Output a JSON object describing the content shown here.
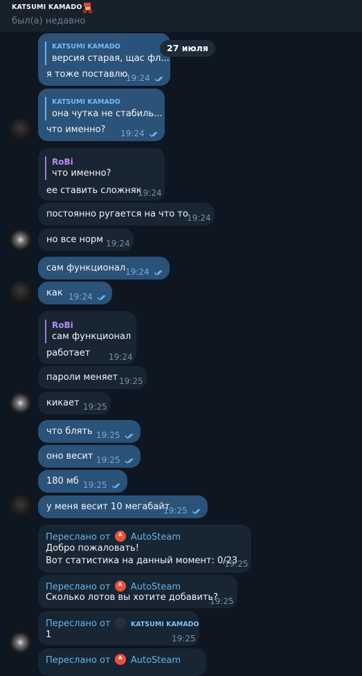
{
  "header": {
    "contact_name": "KATSUMI KAMADO",
    "status": "был(а) недавно"
  },
  "date_separator": "27 июля",
  "messages": [
    {
      "reply_name": "KATSUMI KAMADO",
      "reply_text": "версия старая, щас фл...",
      "text": "я тоже поставлю",
      "time": "19:24",
      "read": true
    },
    {
      "reply_name": "KATSUMI KAMADO",
      "reply_text": "она чутка не стабиль...",
      "text": "что именно?",
      "time": "19:24",
      "read": true
    },
    {
      "reply_name": "RoBi",
      "reply_text": "что именно?",
      "text": "ее ставить сложняк",
      "time": "19:24"
    },
    {
      "text": "постоянно ругается на что то",
      "time": "19:24"
    },
    {
      "text": "но все норм",
      "time": "19:24"
    },
    {
      "text": "сам функционал",
      "time": "19:24",
      "read": true
    },
    {
      "text": "как",
      "time": "19:24",
      "read": true
    },
    {
      "reply_name": "RoBi",
      "reply_text": "сам функционал",
      "text": "работает",
      "time": "19:24"
    },
    {
      "text": "пароли меняет",
      "time": "19:25"
    },
    {
      "text": "кикает",
      "time": "19:25"
    },
    {
      "text": "что блять",
      "time": "19:25",
      "read": true
    },
    {
      "text": "оно весит",
      "time": "19:25",
      "read": true
    },
    {
      "text": "180 мб",
      "time": "19:25",
      "read": true
    },
    {
      "text": "у меня весит 10 мегабайт",
      "time": "19:25",
      "read": true
    },
    {
      "forwarded_label": "Переслано от",
      "forwarded_from": "AutoSteam",
      "line1": "Добро пожаловать!",
      "line2": "Вот статистика на данный момент: 0/23",
      "time": "19:25"
    },
    {
      "forwarded_label": "Переслано от",
      "forwarded_from": "AutoSteam",
      "text": "Сколько лотов вы хотите добавить?",
      "time": "19:25"
    },
    {
      "forwarded_label": "Переслано от",
      "forwarded_from": "KATSUMI KAMADO",
      "text": "1",
      "time": "19:25"
    },
    {
      "forwarded_label": "Переслано от",
      "forwarded_from": "AutoSteam"
    }
  ],
  "colors": {
    "background": "#0e1621",
    "header": "#17212b",
    "outgoing_bubble": "#2b5278",
    "incoming_bubble": "#182533",
    "link_blue": "#66b3ef",
    "reply_purple": "#b48ff0"
  }
}
